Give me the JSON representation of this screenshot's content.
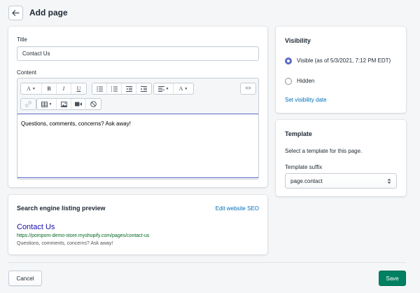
{
  "header": {
    "title": "Add page"
  },
  "main": {
    "title_label": "Title",
    "title_value": "Contact Us",
    "content_label": "Content",
    "content_value": "Questions, comments, concerns? Ask away!",
    "toolbar": {
      "font_button": "A",
      "bold": "B",
      "italic": "I",
      "underline": "U",
      "color_button": "A",
      "html_toggle": "<>"
    }
  },
  "seo": {
    "title": "Search engine listing preview",
    "edit_link": "Edit website SEO",
    "page_title": "Contact Us",
    "url": "https://pompom-demo-store.myshopify.com/pages/contact-us",
    "description": "Questions, comments, concerns? Ask away!"
  },
  "visibility": {
    "heading": "Visibility",
    "options": [
      {
        "label": "Visible (as of 5/3/2021, 7:12 PM EDT)",
        "checked": true
      },
      {
        "label": "Hidden",
        "checked": false
      }
    ],
    "set_date_link": "Set visibility date"
  },
  "template": {
    "heading": "Template",
    "description": "Select a template for this page.",
    "suffix_label": "Template suffix",
    "suffix_value": "page.contact"
  },
  "footer": {
    "cancel_label": "Cancel",
    "save_label": "Save"
  },
  "colors": {
    "primary": "#008060",
    "link": "#006fbb",
    "accent": "#5c6ac4"
  }
}
